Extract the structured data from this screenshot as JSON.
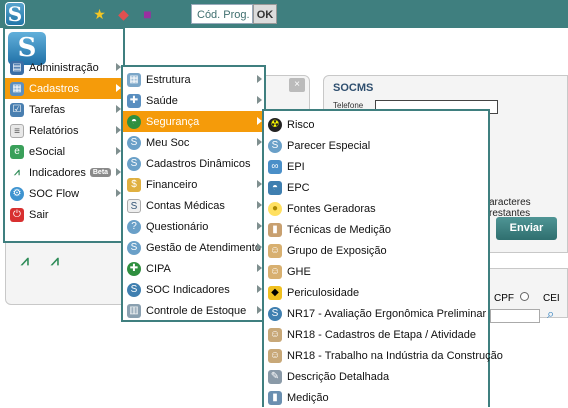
{
  "toolbar": {
    "logo_letter": "S",
    "cod_prog_label": "Cód. Prog.",
    "ok_label": "OK",
    "icons": [
      "star-icon",
      "shapes-icon",
      "bag-icon"
    ]
  },
  "background": {
    "close_glyph": "×",
    "socms_title": "SOCMS",
    "telefone_label": "Telefone",
    "chars_remaining": "aracteres restantes",
    "enviar_label": "Enviar",
    "cpf_label": "CPF",
    "cei_label": "CEI"
  },
  "main_menu": {
    "items": [
      {
        "label": "Administração",
        "icon": "admin-icon"
      },
      {
        "label": "Cadastros",
        "icon": "cadastros-icon",
        "selected": true
      },
      {
        "label": "Tarefas",
        "icon": "tasks-icon"
      },
      {
        "label": "Relatórios",
        "icon": "reports-icon"
      },
      {
        "label": "eSocial",
        "icon": "esocial-icon"
      },
      {
        "label": "Indicadores",
        "icon": "indicators-icon",
        "badge": "Beta"
      },
      {
        "label": "SOC Flow",
        "icon": "flow-icon"
      },
      {
        "label": "Sair",
        "icon": "power-icon"
      }
    ]
  },
  "cadastros_menu": {
    "items": [
      {
        "label": "Estrutura"
      },
      {
        "label": "Saúde"
      },
      {
        "label": "Segurança",
        "selected": true
      },
      {
        "label": "Meu Soc"
      },
      {
        "label": "Cadastros Dinâmicos"
      },
      {
        "label": "Financeiro"
      },
      {
        "label": "Contas Médicas"
      },
      {
        "label": "Questionário"
      },
      {
        "label": "Gestão de Atendimento"
      },
      {
        "label": "CIPA"
      },
      {
        "label": "SOC Indicadores"
      },
      {
        "label": "Controle de Estoque"
      }
    ]
  },
  "seguranca_menu": {
    "items": [
      {
        "label": "Risco"
      },
      {
        "label": "Parecer Especial"
      },
      {
        "label": "EPI"
      },
      {
        "label": "EPC"
      },
      {
        "label": "Fontes Geradoras"
      },
      {
        "label": "Técnicas de Medição"
      },
      {
        "label": "Grupo de Exposição"
      },
      {
        "label": "GHE"
      },
      {
        "label": "Periculosidade"
      },
      {
        "label": "NR17 - Avaliação Ergonômica Preliminar"
      },
      {
        "label": "NR18 - Cadastros de Etapa / Atividade"
      },
      {
        "label": "NR18 - Trabalho na Indústria da Construção"
      },
      {
        "label": "Descrição Detalhada"
      },
      {
        "label": "Medição"
      }
    ]
  },
  "colors": {
    "header": "#3f7f7f",
    "menu_border": "#3f7f7f",
    "selected": "#f59b0a",
    "enviar": "#2f6f6f"
  }
}
